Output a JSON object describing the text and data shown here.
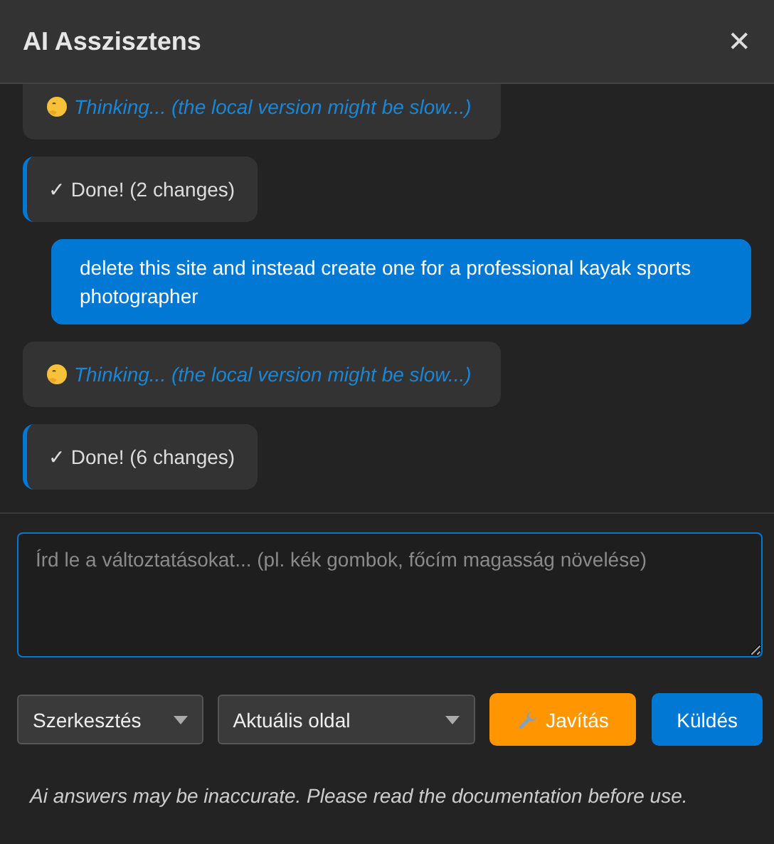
{
  "window": {
    "title": "AI Asszisztens",
    "close": "✕"
  },
  "messages": [
    {
      "kind": "thinking",
      "text": "Thinking... (the local version might be slow...)"
    },
    {
      "kind": "done",
      "text": "✓ Done! (2 changes)"
    },
    {
      "kind": "user",
      "text": "delete this site and instead create one for a professional kayak sports photographer"
    },
    {
      "kind": "thinking",
      "text": "Thinking... (the local version might be slow...)"
    },
    {
      "kind": "done",
      "text": "✓ Done! (6 changes)"
    }
  ],
  "input": {
    "placeholder": "Írd le a változtatásokat... (pl. kék gombok, főcím magasság növelése)"
  },
  "dropdowns": [
    {
      "value": "Szerkesztés"
    },
    {
      "value": "Aktuális oldal"
    }
  ],
  "buttons": [
    {
      "kind": "fix",
      "label": "Javítás"
    },
    {
      "kind": "send",
      "label": "Küldés"
    }
  ],
  "disclaimer": "Ai answers may be inaccurate. Please read the documentation before use."
}
